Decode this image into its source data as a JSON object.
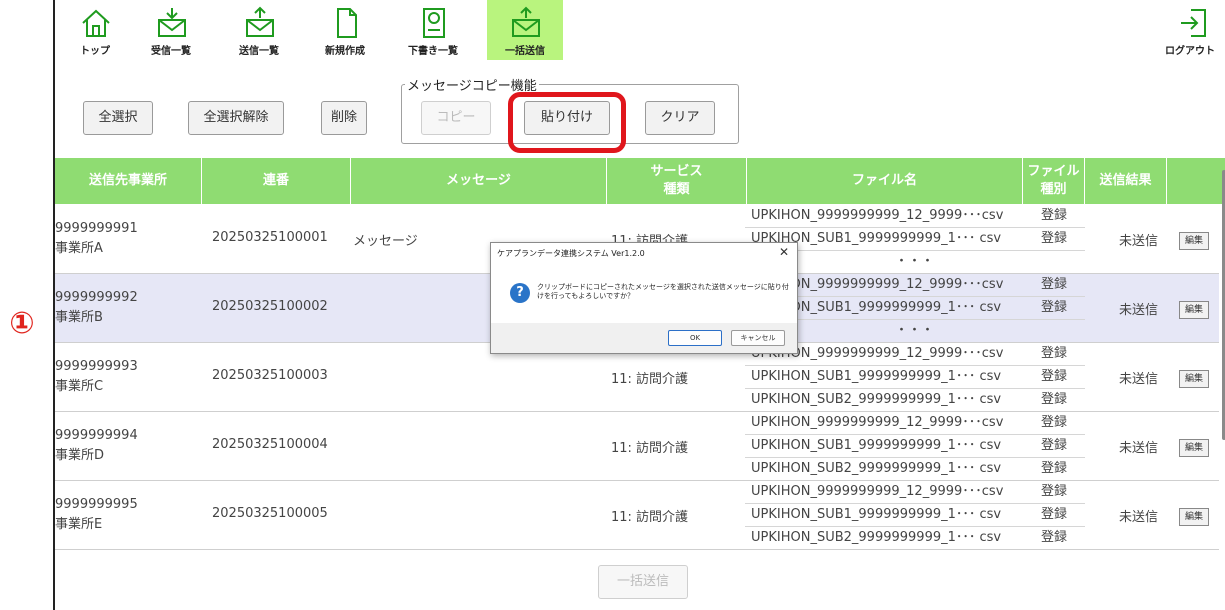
{
  "annotation": {
    "marker": "①"
  },
  "toolbar": {
    "items": [
      {
        "label": "トップ",
        "icon": "home-icon"
      },
      {
        "label": "受信一覧",
        "icon": "inbox-icon"
      },
      {
        "label": "送信一覧",
        "icon": "outbox-icon"
      },
      {
        "label": "新規作成",
        "icon": "new-document-icon"
      },
      {
        "label": "下書き一覧",
        "icon": "drafts-icon"
      },
      {
        "label": "一括送信",
        "icon": "bulk-send-icon",
        "active": true
      }
    ],
    "logout_label": "ログアウト"
  },
  "actions": {
    "select_all": "全選択",
    "deselect_all": "全選択解除",
    "delete": "削除",
    "copy_group_title": "メッセージコピー機能",
    "copy": "コピー",
    "paste": "貼り付け",
    "clear": "クリア"
  },
  "table": {
    "headers": {
      "office": "送信先事業所",
      "serial": "連番",
      "message": "メッセージ",
      "service_1": "サービス",
      "service_2": "種類",
      "filename": "ファイル名",
      "filetype_1": "ファイル",
      "filetype_2": "種別",
      "result": "送信結果"
    },
    "rows": [
      {
        "office_id": "9999999991",
        "office_name": "事業所A",
        "serial": "20250325100001",
        "message": "メッセージ",
        "service": "11: 訪問介護",
        "status": "未送信",
        "edit": "編集",
        "files": [
          {
            "name": "UPKIHON_9999999999_12_9999･･･csv",
            "kind": "登録"
          },
          {
            "name": "UPKIHON_SUB1_9999999999_1･･･ csv",
            "kind": "登録"
          },
          {
            "name": "・・・",
            "kind": ""
          }
        ]
      },
      {
        "office_id": "9999999992",
        "office_name": "事業所B",
        "serial": "20250325100002",
        "message": "",
        "service": "",
        "status": "未送信",
        "edit": "編集",
        "files": [
          {
            "name": "UPKIHON_9999999999_12_9999･･･csv",
            "kind": "登録"
          },
          {
            "name": "UPKIHON_SUB1_9999999999_1･･･ csv",
            "kind": "登録"
          },
          {
            "name": "・・・",
            "kind": ""
          }
        ]
      },
      {
        "office_id": "9999999993",
        "office_name": "事業所C",
        "serial": "20250325100003",
        "message": "",
        "service": "11: 訪問介護",
        "status": "未送信",
        "edit": "編集",
        "files": [
          {
            "name": "UPKIHON_9999999999_12_9999･･･csv",
            "kind": "登録"
          },
          {
            "name": "UPKIHON_SUB1_9999999999_1･･･ csv",
            "kind": "登録"
          },
          {
            "name": "UPKIHON_SUB2_9999999999_1･･･ csv",
            "kind": "登録"
          }
        ]
      },
      {
        "office_id": "9999999994",
        "office_name": "事業所D",
        "serial": "20250325100004",
        "message": "",
        "service": "11: 訪問介護",
        "status": "未送信",
        "edit": "編集",
        "files": [
          {
            "name": "UPKIHON_9999999999_12_9999･･･csv",
            "kind": "登録"
          },
          {
            "name": "UPKIHON_SUB1_9999999999_1･･･ csv",
            "kind": "登録"
          },
          {
            "name": "UPKIHON_SUB2_9999999999_1･･･ csv",
            "kind": "登録"
          }
        ]
      },
      {
        "office_id": "9999999995",
        "office_name": "事業所E",
        "serial": "20250325100005",
        "message": "",
        "service": "11: 訪問介護",
        "status": "未送信",
        "edit": "編集",
        "files": [
          {
            "name": "UPKIHON_9999999999_12_9999･･･csv",
            "kind": "登録"
          },
          {
            "name": "UPKIHON_SUB1_9999999999_1･･･ csv",
            "kind": "登録"
          },
          {
            "name": "UPKIHON_SUB2_9999999999_1･･･ csv",
            "kind": "登録"
          }
        ]
      }
    ]
  },
  "bulk_send_label": "一括送信",
  "dialog": {
    "title": "ケアプランデータ連携システム Ver1.2.0",
    "close": "✕",
    "message": "クリップボードにコピーされたメッセージを選択された送信メッセージに貼り付けを行ってもよろしいですか？",
    "ok": "OK",
    "cancel": "キャンセル"
  },
  "colors": {
    "header_green": "#8fdc72",
    "active_tab": "#b9f47e",
    "highlight_red": "#e0161c",
    "selected_row": "#e6e7f6"
  }
}
